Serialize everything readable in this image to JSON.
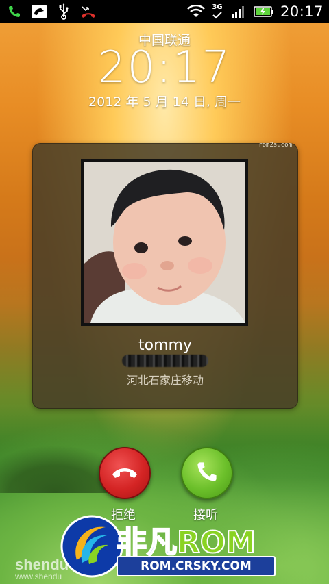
{
  "status_bar": {
    "left_icons": [
      "phone-icon",
      "voicemail-icon",
      "usb-icon",
      "missed-call-icon"
    ],
    "right_icons": [
      "wifi-icon",
      "3g-icon",
      "signal-icon",
      "battery-icon"
    ],
    "network_label": "3G",
    "time": "20:17"
  },
  "lockscreen": {
    "carrier": "中国联通",
    "clock": "20:17",
    "date": "2012 年 5 月 14 日, 周一"
  },
  "caller": {
    "watermark": "rom2s.com",
    "name": "tommy",
    "location": "河北石家庄移动",
    "photo": "caller-photo"
  },
  "actions": {
    "decline_label": "拒绝",
    "answer_label": "接听"
  },
  "branding": {
    "title_cn": "非凡",
    "title_rom": "ROM",
    "url": "ROM.CRSKY.COM",
    "shendu": "shendu",
    "shendu_url": "www.shendu"
  },
  "colors": {
    "decline": "#d42424",
    "answer": "#6bbf2a",
    "card_bg": "#483e28"
  }
}
